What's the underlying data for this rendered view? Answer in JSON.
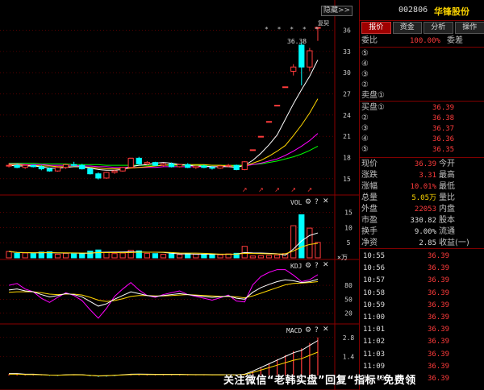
{
  "header": {
    "hide_label": "隐藏>>"
  },
  "colors": {
    "up": "#ff3b3b",
    "down": "#00ffff",
    "grid": "#8b0000",
    "ma5": "#ffffff",
    "ma10": "#ffd700",
    "ma20": "#ff00ff",
    "ma60": "#00ff00"
  },
  "main_chart": {
    "marker_label": "×",
    "star_markers": "* * * * *",
    "price_label": "36.38",
    "corner_label": "复契",
    "y_ticks": [
      "36",
      "33",
      "30",
      "27",
      "24",
      "21",
      "18",
      "15"
    ]
  },
  "vol_panel": {
    "label": "VOL",
    "y_ticks": [
      "15",
      "10",
      "5"
    ],
    "unit": "×万"
  },
  "kdj_panel": {
    "label": "KDJ",
    "y_ticks": [
      "80",
      "50",
      "20"
    ]
  },
  "macd_panel": {
    "label": "MACD",
    "y_ticks": [
      "2.8",
      "1.4"
    ]
  },
  "stock": {
    "code": "002806",
    "name": "华锋股份"
  },
  "tabs": [
    "报价",
    "资金",
    "分析",
    "操作"
  ],
  "order": {
    "weibi_label": "委比",
    "weibi_value": "100.00%",
    "weicha_label": "委差",
    "sell": [
      {
        "label": "⑤",
        "price": "",
        "vol": ""
      },
      {
        "label": "④",
        "price": "",
        "vol": ""
      },
      {
        "label": "③",
        "price": "",
        "vol": ""
      },
      {
        "label": "②",
        "price": "",
        "vol": ""
      },
      {
        "label": "卖盘①",
        "price": "",
        "vol": ""
      }
    ],
    "buy": [
      {
        "label": "买盘①",
        "price": "36.39"
      },
      {
        "label": "②",
        "price": "36.38"
      },
      {
        "label": "③",
        "price": "36.37"
      },
      {
        "label": "④",
        "price": "36.36"
      },
      {
        "label": "⑤",
        "price": "36.35"
      }
    ]
  },
  "quote": [
    {
      "l1": "现价",
      "v1": "36.39",
      "l2": "今开",
      "v1c": "r"
    },
    {
      "l1": "涨跌",
      "v1": "3.31",
      "l2": "最高",
      "v1c": "r"
    },
    {
      "l1": "涨幅",
      "v1": "10.01%",
      "l2": "最低",
      "v1c": "r"
    },
    {
      "l1": "总量",
      "v1": "5.05万",
      "l2": "量比",
      "v1c": "y"
    },
    {
      "l1": "外盘",
      "v1": "22053",
      "l2": "内盘",
      "v1c": "r"
    },
    {
      "l1": "市盈",
      "v1": "330.82",
      "l2": "股本",
      "v1c": "w"
    },
    {
      "l1": "换手",
      "v1": "9.00%",
      "l2": "流通",
      "v1c": "w"
    },
    {
      "l1": "净资",
      "v1": "2.85",
      "l2": "收益(一)",
      "v1c": "w"
    }
  ],
  "ticks": [
    {
      "time": "10:55",
      "price": "36.39"
    },
    {
      "time": "10:56",
      "price": "36.39"
    },
    {
      "time": "10:57",
      "price": "36.39"
    },
    {
      "time": "10:58",
      "price": "36.39"
    },
    {
      "time": "10:59",
      "price": "36.39"
    },
    {
      "time": "11:00",
      "price": "36.39"
    },
    {
      "time": "11:01",
      "price": "36.39"
    },
    {
      "time": "11:02",
      "price": "36.39"
    },
    {
      "time": "11:03",
      "price": "36.39"
    },
    {
      "time": "11:09",
      "price": "36.39"
    },
    {
      "time": "11:10",
      "price": "36.39"
    }
  ],
  "watermark": "关注微信“老韩实盘”回复“指标”免费领",
  "candles": [
    [
      16.9,
      17.2,
      16.6,
      16.9
    ],
    [
      16.9,
      17.1,
      16.5,
      16.6
    ],
    [
      16.6,
      17.0,
      16.4,
      16.9
    ],
    [
      16.9,
      17.0,
      16.6,
      16.7
    ],
    [
      16.7,
      16.9,
      16.2,
      16.4
    ],
    [
      16.4,
      16.6,
      16.0,
      16.1
    ],
    [
      16.1,
      16.8,
      16.0,
      16.6
    ],
    [
      16.6,
      17.1,
      16.4,
      17.0
    ],
    [
      17.0,
      17.4,
      16.8,
      16.9
    ],
    [
      16.9,
      17.1,
      16.3,
      16.4
    ],
    [
      16.4,
      16.6,
      15.6,
      15.7
    ],
    [
      15.7,
      15.9,
      14.9,
      15.1
    ],
    [
      15.1,
      16.0,
      15.0,
      15.9
    ],
    [
      15.9,
      16.3,
      15.7,
      16.1
    ],
    [
      16.1,
      16.7,
      16.0,
      16.6
    ],
    [
      16.6,
      18.0,
      16.5,
      17.9
    ],
    [
      17.9,
      18.1,
      17.0,
      17.1
    ],
    [
      17.1,
      17.5,
      16.9,
      17.3
    ],
    [
      17.3,
      17.4,
      16.8,
      16.9
    ],
    [
      16.9,
      17.2,
      16.7,
      17.1
    ],
    [
      17.1,
      17.3,
      16.6,
      16.7
    ],
    [
      16.7,
      17.1,
      16.6,
      17.0
    ],
    [
      17.0,
      17.2,
      16.5,
      16.6
    ],
    [
      16.6,
      16.9,
      16.4,
      16.8
    ],
    [
      16.8,
      17.0,
      16.5,
      16.6
    ],
    [
      16.6,
      16.8,
      16.3,
      16.5
    ],
    [
      16.5,
      16.9,
      16.4,
      16.8
    ],
    [
      16.8,
      17.1,
      16.6,
      16.9
    ],
    [
      16.9,
      17.0,
      16.2,
      16.3
    ],
    [
      16.3,
      17.5,
      16.2,
      17.4
    ],
    [
      19.1,
      19.1,
      19.1,
      19.1
    ],
    [
      21.0,
      21.0,
      21.0,
      21.0
    ],
    [
      23.1,
      23.1,
      23.1,
      23.1
    ],
    [
      25.4,
      25.4,
      25.4,
      25.4
    ],
    [
      28.0,
      28.0,
      28.0,
      28.0
    ],
    [
      30.2,
      31.2,
      29.6,
      30.8
    ],
    [
      33.9,
      34.3,
      28.2,
      30.8
    ],
    [
      30.8,
      33.5,
      30.2,
      33.1
    ],
    [
      36.4,
      36.4,
      34.5,
      36.4
    ]
  ],
  "volumes": [
    2.1,
    1.5,
    1.6,
    1.4,
    1.9,
    2.0,
    1.2,
    1.5,
    1.3,
    1.4,
    2.2,
    2.6,
    1.8,
    1.4,
    1.6,
    2.5,
    2.3,
    1.5,
    1.4,
    1.2,
    1.3,
    1.1,
    1.4,
    1.2,
    1.1,
    1.2,
    1.0,
    1.3,
    1.5,
    3.8,
    0.6,
    0.7,
    0.8,
    0.9,
    1.4,
    10.6,
    14.2,
    9.8,
    5.1
  ],
  "ma5": [
    16.9,
    16.8,
    16.8,
    16.8,
    16.7,
    16.5,
    16.5,
    16.6,
    16.7,
    16.7,
    16.5,
    16.3,
    16.2,
    16.2,
    16.3,
    16.7,
    16.9,
    17.0,
    17.2,
    17.3,
    17.2,
    17.0,
    16.9,
    16.8,
    16.8,
    16.7,
    16.7,
    16.7,
    16.6,
    16.9,
    17.6,
    18.6,
    19.8,
    21.2,
    23.4,
    25.6,
    27.6,
    29.5,
    31.8
  ],
  "ma10": [
    17.0,
    17.0,
    16.9,
    16.9,
    16.8,
    16.8,
    16.7,
    16.7,
    16.7,
    16.7,
    16.6,
    16.5,
    16.4,
    16.4,
    16.4,
    16.5,
    16.6,
    16.7,
    16.8,
    16.9,
    17.0,
    17.0,
    17.0,
    17.0,
    17.0,
    16.9,
    16.9,
    16.8,
    16.8,
    16.8,
    17.2,
    17.6,
    18.2,
    18.9,
    19.7,
    21.1,
    22.6,
    24.3,
    26.3
  ],
  "ma20": [
    17.1,
    17.1,
    17.0,
    17.0,
    17.0,
    16.9,
    16.9,
    16.9,
    16.9,
    16.8,
    16.8,
    16.7,
    16.7,
    16.6,
    16.6,
    16.6,
    16.6,
    16.6,
    16.6,
    16.7,
    16.7,
    16.7,
    16.7,
    16.7,
    16.7,
    16.7,
    16.7,
    16.8,
    16.8,
    16.8,
    17.0,
    17.2,
    17.5,
    17.8,
    18.3,
    18.9,
    19.6,
    20.4,
    21.4
  ],
  "ma60": [
    17.2,
    17.2,
    17.2,
    17.2,
    17.1,
    17.1,
    17.1,
    17.1,
    17.0,
    17.0,
    17.0,
    17.0,
    16.9,
    16.9,
    16.9,
    16.9,
    16.9,
    16.9,
    16.9,
    16.9,
    16.9,
    16.9,
    16.9,
    16.9,
    16.9,
    16.9,
    16.9,
    16.9,
    16.9,
    16.9,
    17.0,
    17.1,
    17.3,
    17.5,
    17.8,
    18.1,
    18.5,
    19.0,
    19.6
  ],
  "kdj_k": [
    70,
    72,
    68,
    66,
    60,
    55,
    58,
    62,
    60,
    55,
    45,
    35,
    40,
    50,
    58,
    66,
    62,
    58,
    56,
    58,
    60,
    62,
    60,
    58,
    56,
    54,
    55,
    57,
    52,
    50,
    65,
    75,
    82,
    88,
    92,
    90,
    86,
    88,
    93
  ],
  "kdj_d": [
    65,
    66,
    66,
    66,
    64,
    61,
    60,
    61,
    61,
    59,
    54,
    48,
    45,
    47,
    51,
    56,
    58,
    58,
    57,
    57,
    58,
    59,
    60,
    59,
    58,
    57,
    56,
    56,
    55,
    53,
    57,
    63,
    69,
    75,
    81,
    84,
    85,
    86,
    88
  ],
  "kdj_j": [
    80,
    84,
    72,
    66,
    52,
    43,
    54,
    64,
    58,
    47,
    27,
    9,
    30,
    56,
    72,
    86,
    70,
    58,
    54,
    60,
    64,
    68,
    60,
    56,
    52,
    48,
    53,
    59,
    46,
    44,
    81,
    99,
    108,
    114,
    114,
    102,
    88,
    92,
    103
  ],
  "macd_bar": [
    0.1,
    0.1,
    0.05,
    0.05,
    0.02,
    -0.02,
    -0.03,
    0,
    0.02,
    0.01,
    -0.05,
    -0.1,
    -0.08,
    -0.04,
    0,
    0.05,
    0.06,
    0.05,
    0.04,
    0.04,
    0.04,
    0.04,
    0.03,
    0.02,
    0.02,
    0.01,
    0.01,
    0.01,
    0,
    0.05,
    0.3,
    0.6,
    0.9,
    1.2,
    1.5,
    1.8,
    2.0,
    2.4,
    2.8
  ]
}
